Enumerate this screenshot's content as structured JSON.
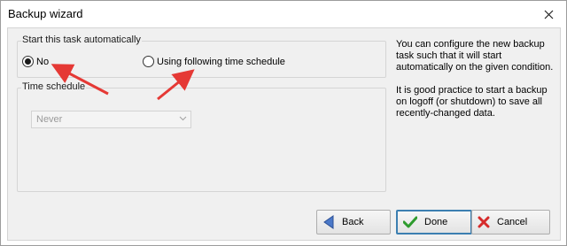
{
  "window": {
    "title": "Backup wizard"
  },
  "start_group": {
    "legend": "Start this task automatically",
    "options": [
      {
        "label": "No",
        "selected": true
      },
      {
        "label": "Using following time schedule",
        "selected": false
      }
    ]
  },
  "schedule_group": {
    "legend": "Time schedule",
    "select_value": "Never"
  },
  "info": {
    "paragraph1": "You can configure the new backup task such that it will start automatically on the given condition.",
    "paragraph2": "It is good practice to start a backup on logoff (or shutdown) to save all recently-changed data."
  },
  "buttons": {
    "back": "Back",
    "done": "Done",
    "cancel": "Cancel"
  },
  "colors": {
    "annotation_arrow": "#e53935",
    "back_icon": "#4a78c8",
    "done_icon": "#2e9b2e",
    "cancel_icon": "#d62b2b"
  }
}
